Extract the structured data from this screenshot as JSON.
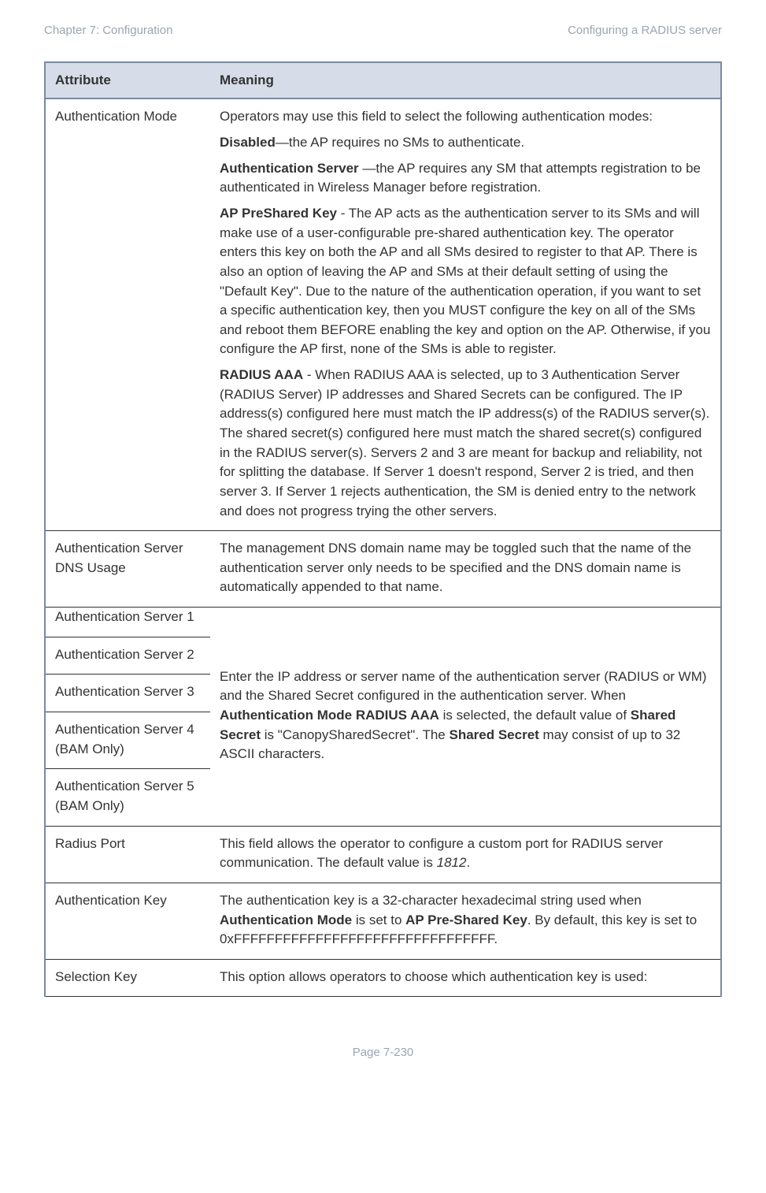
{
  "header": {
    "left": "Chapter 7:  Configuration",
    "right": "Configuring a RADIUS server"
  },
  "table": {
    "columns": {
      "attr": "Attribute",
      "meaning": "Meaning"
    },
    "authMode": {
      "attr": "Authentication Mode",
      "p1": "Operators may use this field to select the following authentication modes:",
      "p2a": "Disabled",
      "p2b": "—the AP requires no SMs to authenticate.",
      "p3a": "Authentication Server ",
      "p3b": "—the AP requires any SM that attempts registration to be authenticated in Wireless Manager before registration.",
      "p4a": "AP PreShared Key",
      "p4b": " - The AP acts as the authentication server to its SMs and will make use of a user-configurable pre-shared authentication key. The operator enters this key on both the AP and all SMs desired to register to that AP. There is also an option of leaving the AP and SMs at their default setting of using the \"Default Key\". Due to the nature of the authentication operation, if you want to set a specific authentication key, then you MUST configure the key on all of the SMs and reboot them BEFORE enabling the key and option on the AP. Otherwise, if you configure the AP first, none of the SMs is able to register.",
      "p5a": "RADIUS AAA",
      "p5b": " - When RADIUS AAA is selected, up to 3 Authentication Server (RADIUS Server) IP addresses and Shared Secrets can be configured. The IP address(s) configured here must match the IP address(s) of the RADIUS server(s). The shared secret(s) configured here must match the shared secret(s) configured in the RADIUS server(s). Servers 2 and 3 are meant for backup and reliability, not for splitting the database. If Server 1 doesn't respond, Server 2 is tried, and then server 3. If Server 1 rejects authentication, the SM is denied entry to the network and does not progress trying the other servers."
    },
    "dnsUsage": {
      "attr": "Authentication Server DNS Usage",
      "meaning": "The management DNS domain name may be toggled such that the name of the authentication server only needs to be specified and the DNS domain name is automatically appended to that name."
    },
    "servers": {
      "s1": "Authentication Server 1",
      "s2": "Authentication Server 2",
      "s3": "Authentication Server 3",
      "s4": "Authentication Server 4 (BAM Only)",
      "s5": "Authentication Server 5 (BAM Only)",
      "meaning_a": "Enter the IP address or server name of the authentication server (RADIUS or WM) and the Shared Secret configured in the authentication server. When ",
      "meaning_b": "Authentication Mode RADIUS AAA",
      "meaning_c": " is selected, the default value of ",
      "meaning_d": "Shared Secret",
      "meaning_e": " is \"CanopySharedSecret\". The ",
      "meaning_f": "Shared Secret",
      "meaning_g": " may consist of up to 32 ASCII characters."
    },
    "radiusPort": {
      "attr": "Radius Port",
      "meaning_a": "This field allows the operator to configure a custom port for RADIUS server communication. The default value is ",
      "meaning_b": "1812",
      "meaning_c": "."
    },
    "authKey": {
      "attr": "Authentication Key",
      "meaning_a": "The authentication key is a 32-character hexadecimal string used when ",
      "meaning_b": "Authentication Mode",
      "meaning_c": " is set to ",
      "meaning_d": "AP Pre-Shared Key",
      "meaning_e": ". By default, this key is set to 0xFFFFFFFFFFFFFFFFFFFFFFFFFFFFFFFF."
    },
    "selectionKey": {
      "attr": "Selection Key",
      "meaning": "This option allows operators to choose which authentication key is used:"
    }
  },
  "footer": {
    "page": "Page 7-230"
  }
}
